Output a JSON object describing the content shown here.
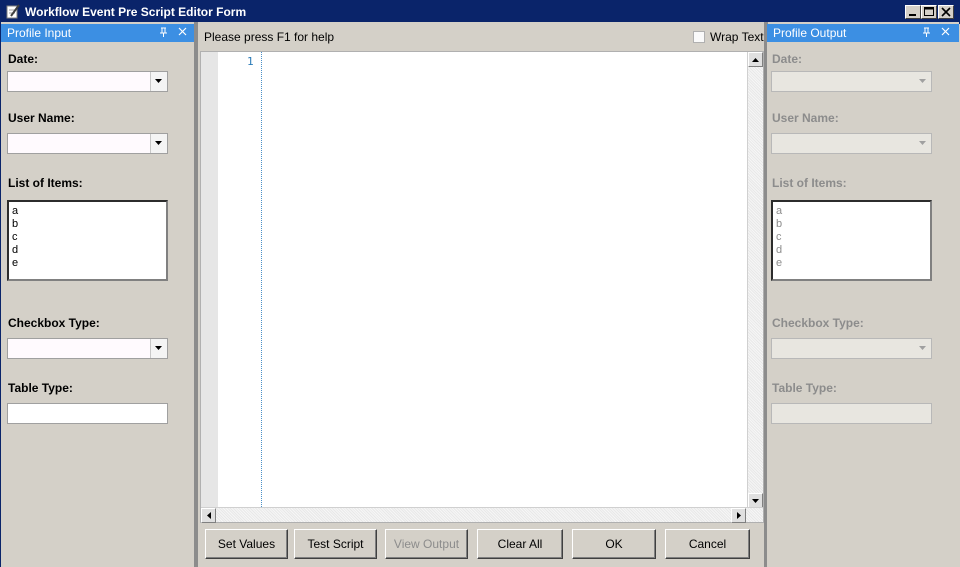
{
  "window": {
    "title": "Workflow Event Pre Script Editor Form",
    "app_icon": "notepad-pencil-icon",
    "controls": [
      "minimize-icon",
      "maximize-icon",
      "close-icon"
    ]
  },
  "profile_input": {
    "title": "Profile Input",
    "date_label": "Date:",
    "username_label": "User Name:",
    "list_label": "List of Items:",
    "list_items": [
      "a",
      "b",
      "c",
      "d",
      "e"
    ],
    "checkbox_label": "Checkbox Type:",
    "table_label": "Table Type:"
  },
  "editor": {
    "help_text": "Please press F1 for help",
    "wrap_text_label": "Wrap Text",
    "wrap_text_checked": false,
    "line_numbers": [
      "1"
    ]
  },
  "profile_output": {
    "title": "Profile Output",
    "date_label": "Date:",
    "username_label": "User Name:",
    "list_label": "List of Items:",
    "list_items": [
      "a",
      "b",
      "c",
      "d",
      "e"
    ],
    "checkbox_label": "Checkbox Type:",
    "table_label": "Table Type:"
  },
  "buttons": {
    "set_values": "Set Values",
    "test_script": "Test Script",
    "view_output": "View Output",
    "clear_all": "Clear All",
    "ok": "OK",
    "cancel": "Cancel"
  },
  "colors": {
    "title_bar": "#0a246a",
    "panel_header": "#3c8fe3",
    "face": "#d4d0c8",
    "line_number": "#2b7bb8"
  }
}
